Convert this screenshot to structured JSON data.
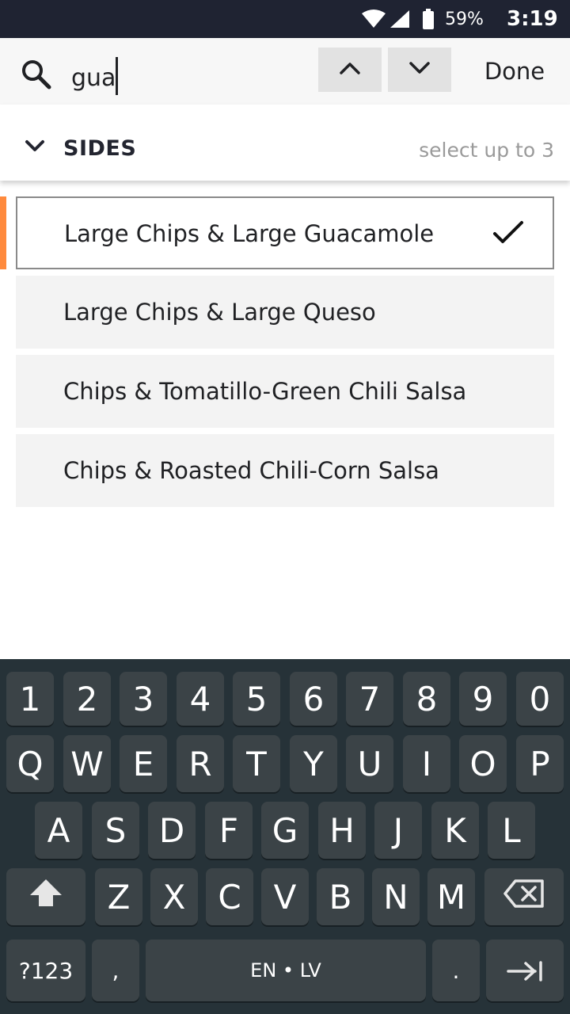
{
  "status_bar": {
    "battery_percent": "59%",
    "time": "3:19",
    "icons": [
      "wifi-icon",
      "cell-signal-icon",
      "battery-icon"
    ]
  },
  "find_bar": {
    "search_icon": "search-icon",
    "query": "gua",
    "prev_icon": "chevron-up-icon",
    "next_icon": "chevron-down-icon",
    "done_label": "Done"
  },
  "section": {
    "title": "SIDES",
    "hint": "select up to 3",
    "collapse_icon": "chevron-down-icon"
  },
  "options": [
    {
      "label": "Large Chips & Large Guacamole",
      "selected": true
    },
    {
      "label": "Large Chips & Large Queso",
      "selected": false
    },
    {
      "label": "Chips & Tomatillo-Green Chili Salsa",
      "selected": false
    },
    {
      "label": "Chips & Roasted Chili-Corn Salsa",
      "selected": false
    }
  ],
  "keyboard": {
    "row1": [
      "1",
      "2",
      "3",
      "4",
      "5",
      "6",
      "7",
      "8",
      "9",
      "0"
    ],
    "row2": [
      "Q",
      "W",
      "E",
      "R",
      "T",
      "Y",
      "U",
      "I",
      "O",
      "P"
    ],
    "row3": [
      "A",
      "S",
      "D",
      "F",
      "G",
      "H",
      "J",
      "K",
      "L"
    ],
    "row4": [
      "Z",
      "X",
      "C",
      "V",
      "B",
      "N",
      "M"
    ],
    "symbols_label": "?123",
    "comma_label": ",",
    "space_label": "EN • LV",
    "period_label": ".",
    "shift_icon": "shift-icon",
    "backspace_icon": "backspace-icon",
    "enter_icon": "tab-next-icon"
  },
  "colors": {
    "status_bar": "#1f2332",
    "accent": "#ff8a3d",
    "keyboard_bg": "#263238",
    "key_bg": "#3b4347"
  }
}
